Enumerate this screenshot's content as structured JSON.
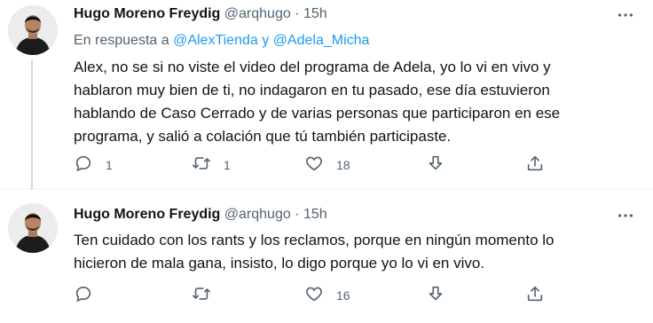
{
  "tweets": [
    {
      "author_name": "Hugo Moreno Freydig",
      "handle": "@arqhugo",
      "separator": "·",
      "time": "15h",
      "reply_prefix": "En respuesta a",
      "reply_mention1": "@AlexTienda",
      "reply_conjunction": "y",
      "reply_mention2": "@Adela_Micha",
      "lines": [
        "Alex, no se si no viste el video del programa de Adela, yo lo vi en vivo y",
        "hablaron muy bien de ti, no indagaron en tu pasado, ese día estuvieron",
        "hablando de Caso Cerrado y de varias personas que participaron en ese",
        "programa, y salió a colación que tú también participaste."
      ],
      "replies": "1",
      "retweets": "1",
      "likes": "18"
    },
    {
      "author_name": "Hugo Moreno Freydig",
      "handle": "@arqhugo",
      "separator": "·",
      "time": "15h",
      "lines": [
        "Ten cuidado con los rants y los reclamos, porque en ningún momento lo",
        "hicieron de mala gana, insisto, lo digo porque yo lo vi en vivo."
      ],
      "replies": "",
      "retweets": "",
      "likes": "16"
    }
  ],
  "icons": {
    "reply": "reply-icon",
    "retweet": "retweet-icon",
    "like": "heart-icon",
    "download": "download-icon",
    "share": "share-icon",
    "more": "more-icon"
  },
  "colors": {
    "name": "#0f1419",
    "secondary": "#536471",
    "mention": "#1d9bf0",
    "thread_line": "#cfd9de"
  }
}
